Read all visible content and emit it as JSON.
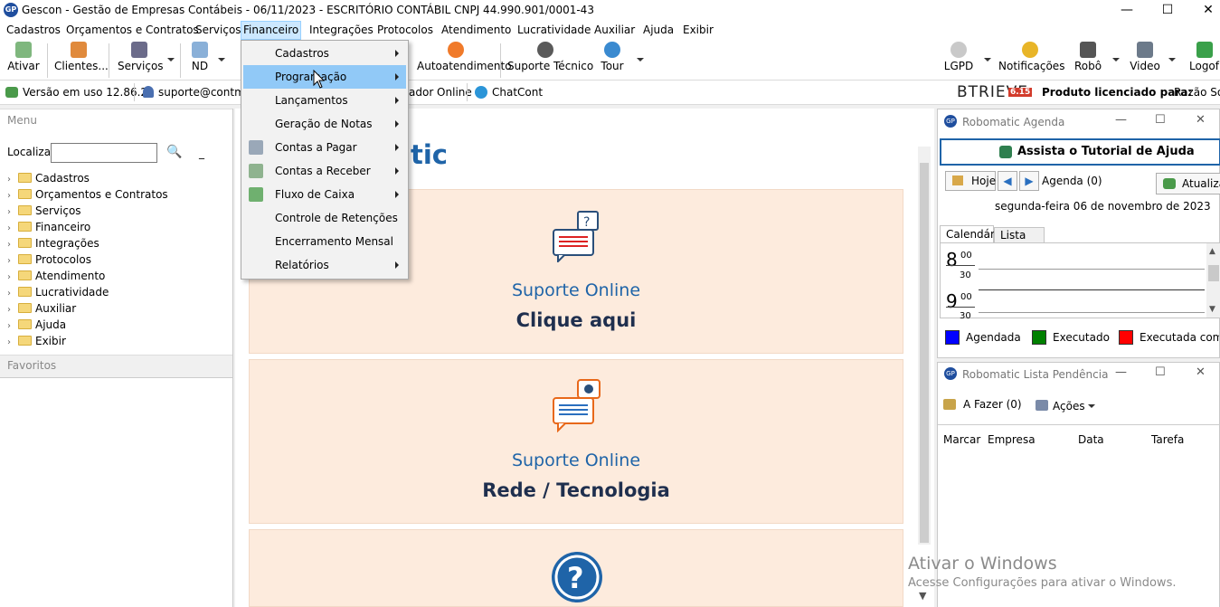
{
  "window": {
    "app_icon": "GP",
    "title": "Gescon - Gestão de Empresas Contábeis - 06/11/2023 - ESCRITÓRIO CONTÁBIL CNPJ 44.990.901/0001-43",
    "controls": {
      "minimize": "—",
      "maximize": "☐",
      "close": "✕"
    }
  },
  "menubar": {
    "items": [
      "Cadastros",
      "Orçamentos e Contratos",
      "Serviços",
      "Financeiro",
      "Integrações",
      "Protocolos",
      "Atendimento",
      "Lucratividade",
      "Auxiliar",
      "Ajuda",
      "Exibir"
    ],
    "active": "Financeiro"
  },
  "toolbar": {
    "ativar": "Ativar",
    "clientes": "Clientes...",
    "servicos": "Serviços",
    "nd": "ND",
    "autoatendimento": "Autoatendimento",
    "suporte_tecnico": "Suporte Técnico",
    "tour": "Tour",
    "lgpd": "LGPD",
    "notificacoes": "Notificações",
    "robo": "Robô",
    "video": "Video",
    "logoff": "Logof"
  },
  "statusbar": {
    "version": "Versão em uso 12.86.2",
    "user": "suporte@contmark",
    "online": "ador Online",
    "chat": "ChatCont",
    "brand": "BTRIEVE",
    "brand_version": "6.15",
    "license_label": "Produto licenciado para:",
    "license_value": "Razão Soc"
  },
  "left": {
    "menu_header": "Menu",
    "search_label": "Localizar",
    "search_value": "",
    "tree": [
      "Cadastros",
      "Orçamentos e Contratos",
      "Serviços",
      "Financeiro",
      "Integrações",
      "Protocolos",
      "Atendimento",
      "Lucratividade",
      "Auxiliar",
      "Ajuda",
      "Exibir"
    ],
    "favorites_header": "Favoritos"
  },
  "center": {
    "heading_partial": "tic",
    "cards": [
      {
        "title": "Suporte Online",
        "subtitle": "Clique aqui"
      },
      {
        "title": "Suporte Online",
        "subtitle": "Rede / Tecnologia"
      }
    ]
  },
  "dropdown": {
    "items": [
      {
        "label": "Cadastros",
        "submenu": true
      },
      {
        "label": "Programação",
        "submenu": true,
        "highlighted": true
      },
      {
        "label": "Lançamentos",
        "submenu": true
      },
      {
        "label": "Geração de Notas",
        "submenu": true
      },
      {
        "label": "Contas a Pagar",
        "submenu": true
      },
      {
        "label": "Contas a Receber",
        "submenu": true
      },
      {
        "label": "Fluxo de Caixa",
        "submenu": true
      },
      {
        "label": "Controle de Retenções",
        "submenu": false
      },
      {
        "label": "Encerramento Mensal",
        "submenu": false
      },
      {
        "label": "Relatórios",
        "submenu": true
      }
    ]
  },
  "agenda": {
    "title": "Robomatic Agenda",
    "tutorial": "Assista o Tutorial de Ajuda",
    "today": "Hoje",
    "agenda_count": "Agenda (0)",
    "refresh": "Atualizar",
    "date": "segunda-feira 06 de novembro de 2023",
    "tabs": [
      "Calendário",
      "Lista"
    ],
    "hours": [
      {
        "hour": "8",
        "mins": "00",
        "half": "30"
      },
      {
        "hour": "9",
        "mins": "00",
        "half": "30"
      }
    ],
    "legend": [
      {
        "label": "Agendada",
        "color": "#0000ff"
      },
      {
        "label": "Executado",
        "color": "#008000"
      },
      {
        "label": "Executada com erro",
        "color": "#ff0000"
      }
    ]
  },
  "pendencias": {
    "title": "Robomatic Lista Pendência",
    "todo": "A Fazer (0)",
    "actions": "Ações",
    "columns": [
      "Marcar",
      "Empresa",
      "Data",
      "Tarefa"
    ]
  },
  "watermark": {
    "line1": "Ativar o Windows",
    "line2": "Acesse Configurações para ativar o Windows."
  },
  "colors": {
    "accent": "#1f64a8",
    "highlight": "#91c9f7",
    "card_bg": "#fdebdd"
  }
}
